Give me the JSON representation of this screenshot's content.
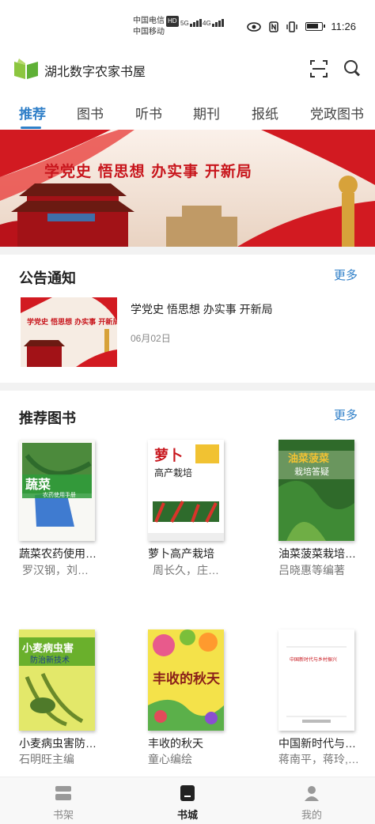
{
  "status_bar": {
    "carrier1": "中国电信",
    "carrier1_badge": "HD",
    "carrier2": "中国移动",
    "net1": "5G",
    "net2": "4G",
    "time": "11:26"
  },
  "header": {
    "app_title": "湖北数字农家书屋"
  },
  "tabs": [
    {
      "label": "推荐",
      "active": true
    },
    {
      "label": "图书"
    },
    {
      "label": "听书"
    },
    {
      "label": "期刊"
    },
    {
      "label": "报纸"
    },
    {
      "label": "党政图书"
    }
  ],
  "banner": {
    "slogan": "学党史  悟思想  办实事  开新局"
  },
  "notice": {
    "section_title": "公告通知",
    "more": "更多",
    "item": {
      "thumb_text": "学党史  悟思想  办实事  开新局",
      "title": "学党史 悟思想 办实事 开新局",
      "date": "06月02日"
    }
  },
  "recommend": {
    "section_title": "推荐图书",
    "more": "更多",
    "books": [
      {
        "title": "蔬菜农药使用…",
        "author": "罗汉钢，刘…",
        "cover_title": "蔬菜",
        "cover_sub": "农药使用手册"
      },
      {
        "title": "萝卜高产栽培",
        "author": "周长久，庄…",
        "cover_title": "萝卜",
        "cover_sub": "高产栽培"
      },
      {
        "title": "油菜菠菜栽培…",
        "author": "吕晓惠等编著",
        "cover_title": "油菜菠菜",
        "cover_sub": "栽培答疑"
      },
      {
        "title": "小麦病虫害防…",
        "author": "石明旺主编",
        "cover_title": "小麦病虫害",
        "cover_sub": "防治新技术"
      },
      {
        "title": "丰收的秋天",
        "author": "童心编绘",
        "cover_title": "丰收的秋天",
        "cover_sub": ""
      },
      {
        "title": "中国新时代与…",
        "author": "蒋南平，蒋玲,…",
        "cover_title": "中国新时代与乡村振兴",
        "cover_sub": ""
      }
    ]
  },
  "bottom_nav": [
    {
      "label": "书架",
      "icon": "bookshelf-icon"
    },
    {
      "label": "书城",
      "icon": "bookstore-icon",
      "active": true
    },
    {
      "label": "我的",
      "icon": "user-icon"
    }
  ],
  "colors": {
    "accent": "#2f7fc8",
    "banner_red": "#c8161d"
  }
}
